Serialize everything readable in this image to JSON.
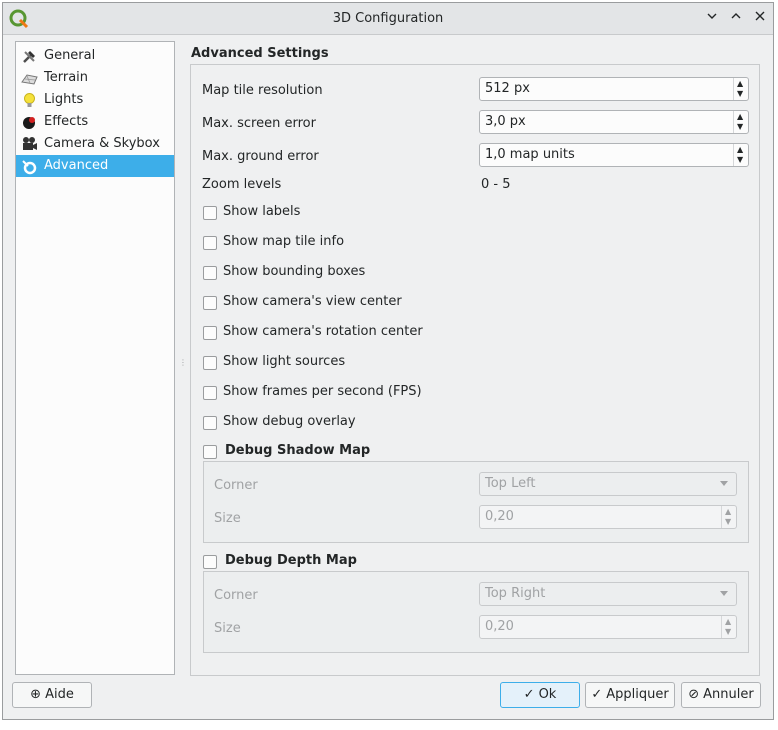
{
  "window": {
    "title": "3D Configuration"
  },
  "sidebar": {
    "items": [
      {
        "label": "General",
        "icon": "hammer-icon"
      },
      {
        "label": "Terrain",
        "icon": "terrain-icon"
      },
      {
        "label": "Lights",
        "icon": "lightbulb-icon"
      },
      {
        "label": "Effects",
        "icon": "effects-icon"
      },
      {
        "label": "Camera & Skybox",
        "icon": "camera-icon"
      },
      {
        "label": "Advanced",
        "icon": "advanced-icon",
        "selected": true
      }
    ]
  },
  "advanced": {
    "section_title": "Advanced Settings",
    "map_tile_resolution": {
      "label": "Map tile resolution",
      "value": "512 px"
    },
    "max_screen_error": {
      "label": "Max. screen error",
      "value": "3,0 px"
    },
    "max_ground_error": {
      "label": "Max. ground error",
      "value": "1,0 map units"
    },
    "zoom_levels": {
      "label": "Zoom levels",
      "value": "0 - 5"
    },
    "checkboxes": [
      {
        "label": "Show labels",
        "checked": false
      },
      {
        "label": "Show map tile info",
        "checked": false
      },
      {
        "label": "Show bounding boxes",
        "checked": false
      },
      {
        "label": "Show camera's view center",
        "checked": false
      },
      {
        "label": "Show camera's rotation center",
        "checked": false
      },
      {
        "label": "Show light sources",
        "checked": false
      },
      {
        "label": "Show frames per second (FPS)",
        "checked": false
      },
      {
        "label": "Show debug overlay",
        "checked": false
      }
    ],
    "debug_shadow_map": {
      "label": "Debug Shadow Map",
      "checked": false,
      "corner_label": "Corner",
      "corner_value": "Top Left",
      "size_label": "Size",
      "size_value": "0,20"
    },
    "debug_depth_map": {
      "label": "Debug Depth Map",
      "checked": false,
      "corner_label": "Corner",
      "corner_value": "Top Right",
      "size_label": "Size",
      "size_value": "0,20"
    }
  },
  "footer": {
    "help_label": "Aide",
    "ok_label": "Ok",
    "apply_label": "Appliquer",
    "cancel_label": "Annuler"
  },
  "colors": {
    "accent": "#3daee9",
    "window_bg": "#eff0f1",
    "field_bg": "#fcfcfc"
  }
}
